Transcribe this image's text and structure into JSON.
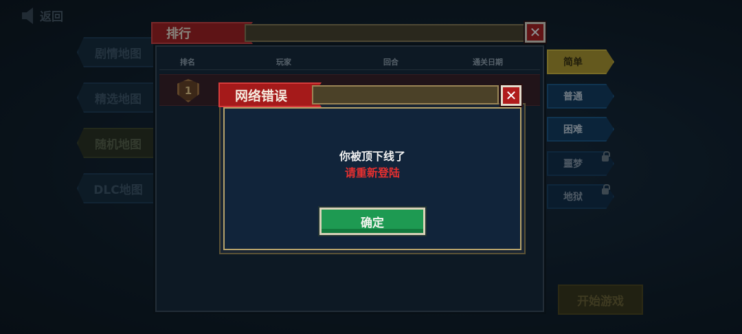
{
  "background": {
    "back_label": "返回",
    "map_tabs": [
      {
        "label": "剧情地图"
      },
      {
        "label": "精选地图"
      },
      {
        "label": "随机地图"
      },
      {
        "label": "DLC地图"
      }
    ],
    "difficulty": [
      {
        "label": "简单"
      },
      {
        "label": "普通"
      },
      {
        "label": "困难"
      },
      {
        "label": "噩梦"
      },
      {
        "label": "地狱"
      }
    ],
    "start_label": "开始游戏"
  },
  "ranking": {
    "title": "排行",
    "close_symbol": "✕",
    "columns": [
      "排名",
      "玩家",
      "回合",
      "通关日期"
    ],
    "first_rank": "1"
  },
  "error_dialog": {
    "title": "网络错误",
    "close_symbol": "✕",
    "message": "你被顶下线了",
    "sub_message": "请重新登陆",
    "confirm_label": "确定"
  }
}
